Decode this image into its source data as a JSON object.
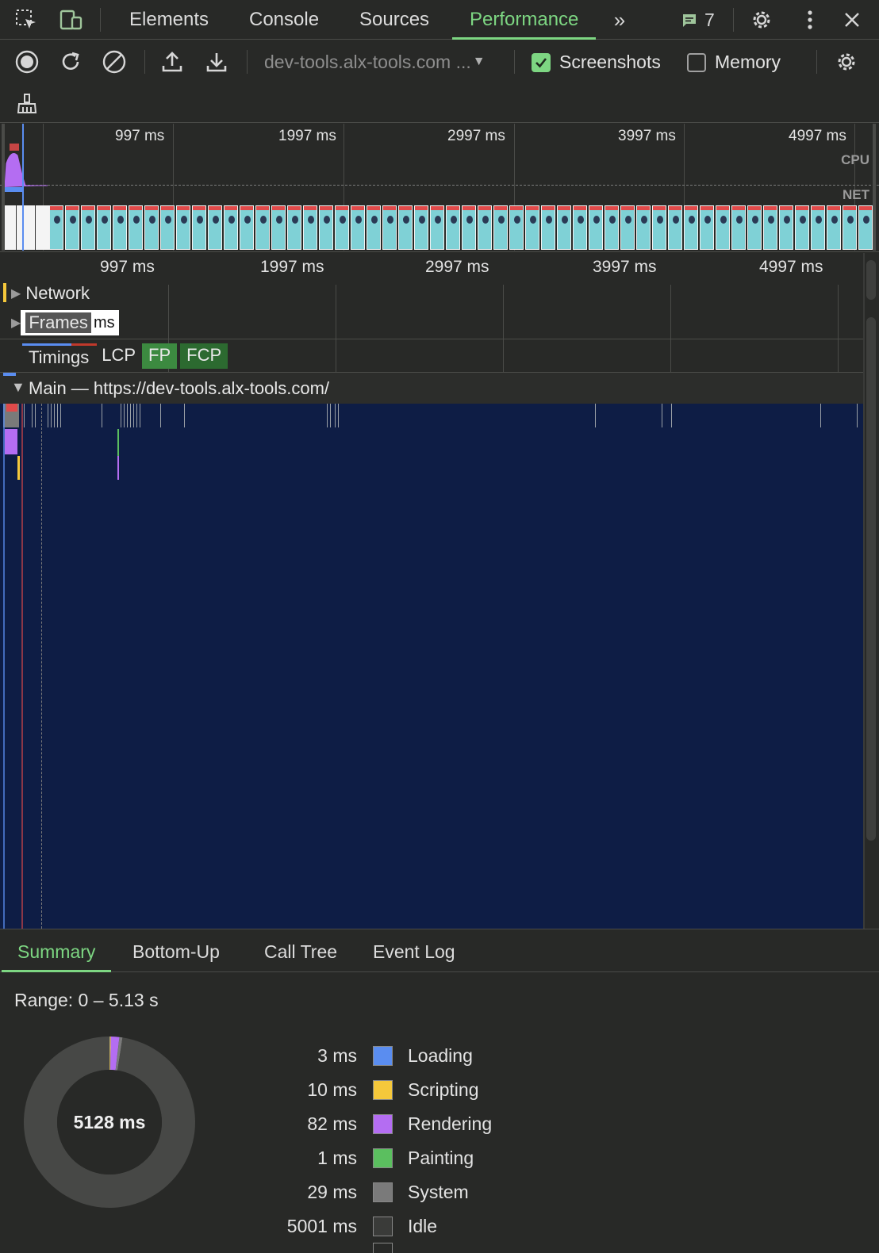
{
  "tabs": [
    {
      "label": "Elements"
    },
    {
      "label": "Console"
    },
    {
      "label": "Sources"
    },
    {
      "label": "Performance"
    }
  ],
  "issues_count": "7",
  "toolbar": {
    "url_select": "dev-tools.alx-tools.com ...",
    "screenshots_label": "Screenshots",
    "screenshots_checked": true,
    "memory_label": "Memory",
    "memory_checked": false
  },
  "overview": {
    "ticks_top": [
      "997 ms",
      "1997 ms",
      "2997 ms",
      "3997 ms",
      "4997 ms"
    ],
    "cpu_label": "CPU",
    "net_label": "NET"
  },
  "timeline": {
    "ticks": [
      "997 ms",
      "1997 ms",
      "2997 ms",
      "3997 ms",
      "4997 ms"
    ],
    "tracks": {
      "network": "Network",
      "frames": "Frames",
      "frames_overlay": "ms",
      "timings": "Timings",
      "lcp": "LCP",
      "fp": "FP",
      "fcp": "FCP",
      "main": "Main — https://dev-tools.alx-tools.com/"
    }
  },
  "bottom_tabs": [
    {
      "label": "Summary"
    },
    {
      "label": "Bottom-Up"
    },
    {
      "label": "Call Tree"
    },
    {
      "label": "Event Log"
    }
  ],
  "summary": {
    "range": "Range: 0 – 5.13 s",
    "total": "5128 ms",
    "items": [
      {
        "value": "3 ms",
        "label": "Loading",
        "color": "#5a8df0",
        "ms": 3
      },
      {
        "value": "10 ms",
        "label": "Scripting",
        "color": "#f5c83b",
        "ms": 10
      },
      {
        "value": "82 ms",
        "label": "Rendering",
        "color": "#b46df2",
        "ms": 82
      },
      {
        "value": "1 ms",
        "label": "Painting",
        "color": "#5bbf5f",
        "ms": 1
      },
      {
        "value": "29 ms",
        "label": "System",
        "color": "#7a7a7a",
        "ms": 29
      },
      {
        "value": "5001 ms",
        "label": "Idle",
        "color": "#3a3b39",
        "ms": 5001
      }
    ]
  }
}
